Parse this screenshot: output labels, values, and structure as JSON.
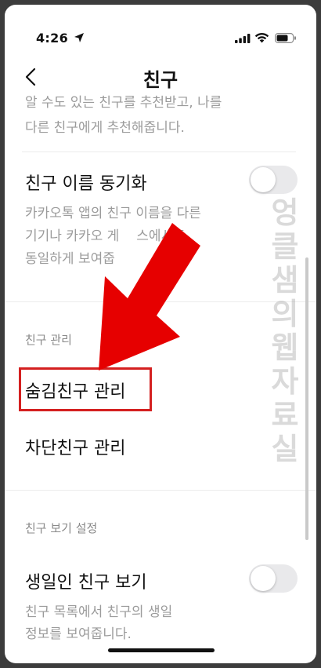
{
  "status_bar": {
    "time": "4:26"
  },
  "header": {
    "title": "친구",
    "back_icon": "chevron-left-icon"
  },
  "recommend_desc": {
    "line1": "알 수도 있는 친구를 추천받고, 나를",
    "line2": "다른 친구에게 추천해줍니다."
  },
  "sync": {
    "title": "친구 이름 동기화",
    "desc_line1": "카카오톡 앱의 친구 이름을 다른",
    "desc_line2": "기기나 카카오 게",
    "desc_line2_tail": "스에서도",
    "desc_line3": "동일하게 보여줍",
    "toggle_on": false
  },
  "manage_section": {
    "label": "친구 관리",
    "items": [
      {
        "label": "숨김친구 관리"
      },
      {
        "label": "차단친구 관리"
      }
    ]
  },
  "view_section": {
    "label": "친구 보기 설정",
    "birthday_title": "생일인 친구 보기",
    "birthday_desc_line1": "친구 목록에서 친구의 생일",
    "birthday_desc_line2": "정보를 보여줍니다.",
    "toggle_on": false
  },
  "watermark": "엉클샘의웹자료실",
  "colors": {
    "accent_red": "#e60000",
    "highlight_border": "#d42020",
    "toggle_off": "#e9e9eb"
  }
}
